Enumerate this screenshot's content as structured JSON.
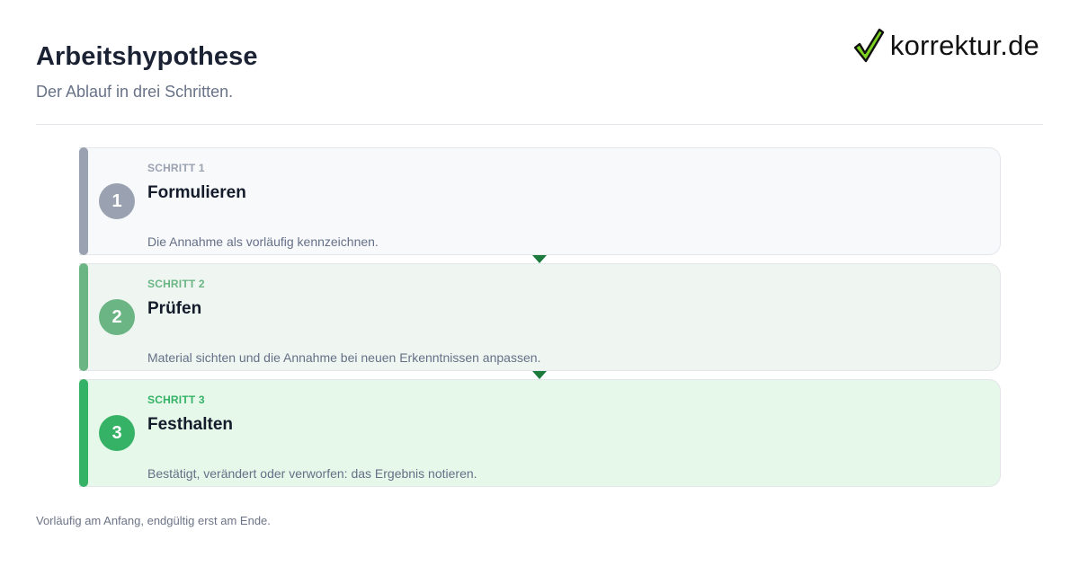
{
  "header": {
    "title": "Arbeitshypothese",
    "subtitle": "Der Ablauf in drei Schritten."
  },
  "logo": {
    "text": "korrektur.de",
    "icon": "checkmark-icon"
  },
  "steps": [
    {
      "number": "1",
      "label": "SCHRITT 1",
      "title": "Formulieren",
      "description": "Die Annahme als vorläufig kennzeichnen.",
      "accent_color": "#9aa2b1",
      "background_color": "#f8f9fb"
    },
    {
      "number": "2",
      "label": "SCHRITT 2",
      "title": "Prüfen",
      "description": "Material sichten und die Annahme bei neuen Erkenntnissen anpassen.",
      "accent_color": "#6bb584",
      "background_color": "#eff6f1"
    },
    {
      "number": "3",
      "label": "SCHRITT 3",
      "title": "Festhalten",
      "description": "Bestätigt, verändert oder verworfen: das Ergebnis notieren.",
      "accent_color": "#35b265",
      "background_color": "#e6f8ea"
    }
  ],
  "connector_color": "#1b7a3c",
  "footer": {
    "note": "Vorläufig am Anfang, endgültig erst am Ende."
  }
}
